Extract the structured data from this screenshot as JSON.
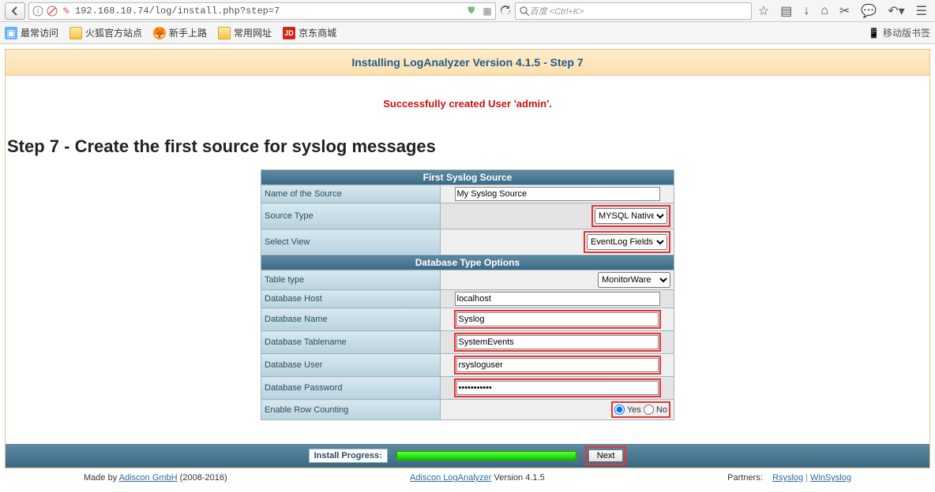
{
  "browser": {
    "url": "192.168.10.74/log/install.php?step=7",
    "search_placeholder": "百度 <Ctrl+K>",
    "bookmarks": [
      {
        "label": "最常访问",
        "icon": "badge"
      },
      {
        "label": "火狐官方站点",
        "icon": "folder"
      },
      {
        "label": "新手上路",
        "icon": "ff"
      },
      {
        "label": "常用网址",
        "icon": "folder"
      },
      {
        "label": "京东商城",
        "icon": "jd"
      }
    ],
    "mobile_label": "移动版书签"
  },
  "title_bar": "Installing LogAnalyzer Version 4.1.5 - Step 7",
  "success_msg": "Successfully created User 'admin'.",
  "step_header": "Step 7 - Create the first source for syslog messages",
  "section1": "First Syslog Source",
  "section2": "Database Type Options",
  "labels": {
    "name": "Name of the Source",
    "source_type": "Source Type",
    "select_view": "Select View",
    "table_type": "Table type",
    "db_host": "Database Host",
    "db_name": "Database Name",
    "db_table": "Database Tablename",
    "db_user": "Database User",
    "db_pass": "Database Password",
    "row_count": "Enable Row Counting"
  },
  "values": {
    "name": "My Syslog Source",
    "source_type": "MYSQL Native",
    "select_view": "EventLog Fields",
    "table_type": "MonitorWare",
    "db_host": "localhost",
    "db_name": "Syslog",
    "db_table": "SystemEvents",
    "db_user": "rsysloguser",
    "db_pass": "••••••••••",
    "row_yes": "Yes",
    "row_no": "No"
  },
  "progress": {
    "label": "Install Progress:",
    "percent": 100,
    "next_label": "Next"
  },
  "footer": {
    "left_prefix": "Made by ",
    "left_link": "Adiscon GmbH",
    "left_suffix": " (2008-2016)",
    "center_link": "Adiscon LogAnalyzer",
    "center_suffix": " Version 4.1.5",
    "partners": "Partners:",
    "p1": "Rsyslog",
    "p2": "WinSyslog"
  }
}
